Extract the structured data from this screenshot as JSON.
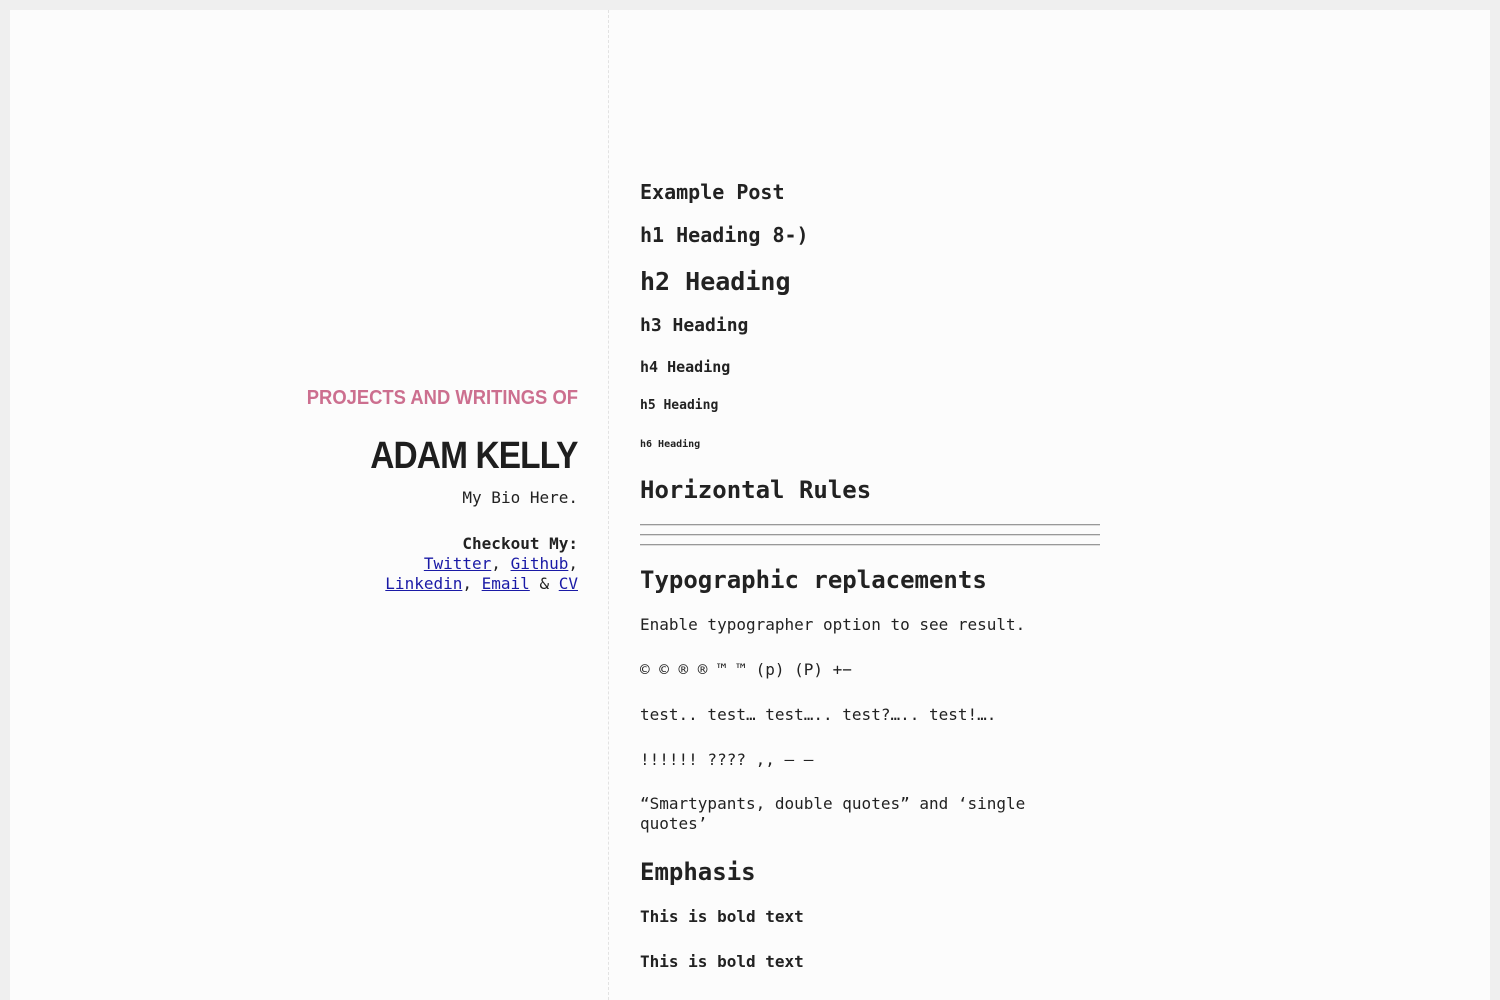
{
  "sidebar": {
    "tagline": "PROJECTS AND WRITINGS OF",
    "name": "ADAM KELLY",
    "bio": "My Bio Here.",
    "checkout_label": "Checkout My:",
    "links": {
      "twitter": "Twitter",
      "github": "Github",
      "linkedin": "Linkedin",
      "email": "Email",
      "cv": "CV"
    },
    "sep_comma": ",",
    "sep_amp": "&"
  },
  "post": {
    "title": "Example Post",
    "h1": "h1 Heading 8-)",
    "h2": "h2 Heading",
    "h3": "h3 Heading",
    "h4": "h4 Heading",
    "h5": "h5 Heading",
    "h6": "h6 Heading",
    "hr_title": "Horizontal Rules",
    "typo_title": "Typographic replacements",
    "typo_lines": [
      "Enable typographer option to see result.",
      "© © ® ® ™ ™ (p) (P) +−",
      "test.. test… test….. test?….. test!….",
      "!!!!!! ???? ,, – —",
      "“Smartypants, double quotes” and ‘single quotes’"
    ],
    "emphasis_title": "Emphasis",
    "bold_lines": [
      "This is bold text",
      "This is bold text"
    ]
  }
}
